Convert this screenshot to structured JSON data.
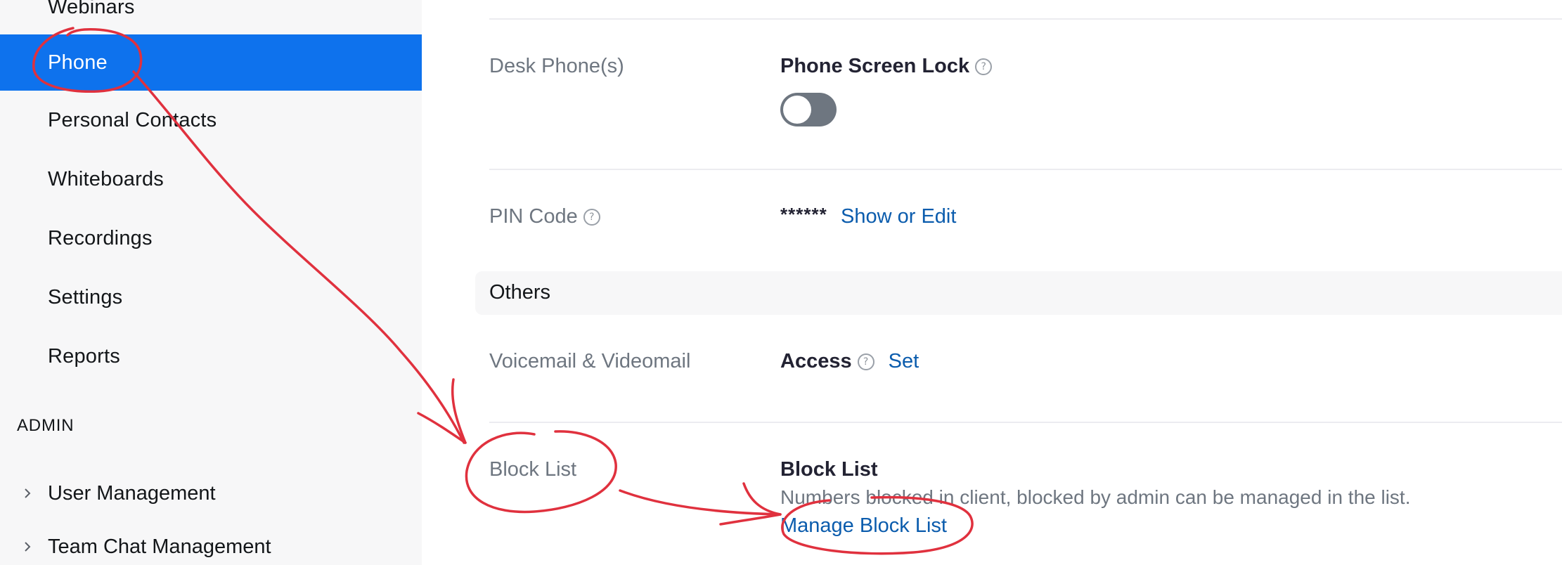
{
  "sidebar": {
    "items": [
      {
        "label": "Webinars"
      },
      {
        "label": "Phone",
        "active": true
      },
      {
        "label": "Personal Contacts"
      },
      {
        "label": "Whiteboards"
      },
      {
        "label": "Recordings"
      },
      {
        "label": "Settings"
      },
      {
        "label": "Reports"
      }
    ],
    "admin_header": "ADMIN",
    "admin_groups": [
      {
        "label": "User Management",
        "icon": "chevron-right-icon"
      },
      {
        "label": "Team Chat Management",
        "icon": "chevron-right-icon"
      }
    ]
  },
  "main": {
    "desk_phone": {
      "label": "Desk Phone(s)",
      "title": "Phone Screen Lock",
      "help_icon": "help-circle-icon",
      "toggle_on": false
    },
    "pin_code": {
      "label": "PIN Code",
      "help_icon": "help-circle-icon",
      "mask": "******",
      "link": "Show or Edit"
    },
    "section_others": "Others",
    "voicemail": {
      "label": "Voicemail & Videomail",
      "title": "Access",
      "help_icon": "help-circle-icon",
      "link": "Set"
    },
    "block_list": {
      "label": "Block List",
      "title": "Block List",
      "description": "Numbers blocked in client, blocked by admin can be managed in the list.",
      "link": "Manage Block List"
    }
  },
  "colors": {
    "active_nav": "#0e72ed",
    "link": "#0b5cad",
    "annotation": "#e0313e",
    "toggle_off": "#6e7680"
  }
}
